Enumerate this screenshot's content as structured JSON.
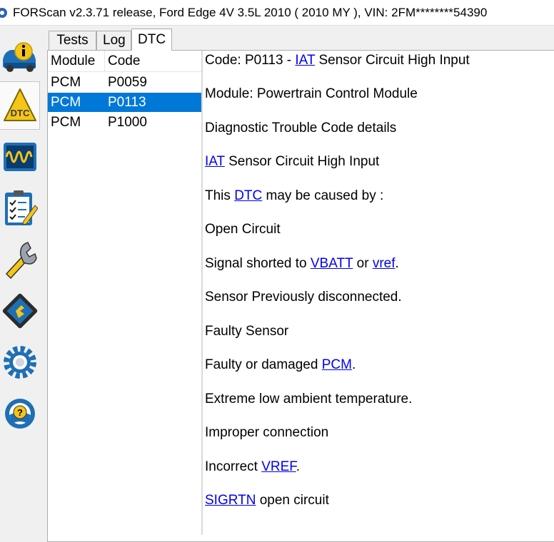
{
  "window": {
    "title": "FORScan v2.3.71 release, Ford Edge 4V 3.5L 2010 ( 2010 MY ), VIN: 2FM********54390"
  },
  "toolbar": {
    "buttons": [
      {
        "name": "vehicle-info",
        "icon": "info-car-icon",
        "active": false
      },
      {
        "name": "dtc",
        "icon": "dtc-warning-icon",
        "active": true,
        "label": "DTC"
      },
      {
        "name": "oscilloscope",
        "icon": "waveform-icon",
        "active": false
      },
      {
        "name": "tests",
        "icon": "checklist-icon",
        "active": false
      },
      {
        "name": "service",
        "icon": "wrench-icon",
        "active": false
      },
      {
        "name": "config",
        "icon": "chip-icon",
        "active": false
      },
      {
        "name": "settings",
        "icon": "gear-icon",
        "active": false
      },
      {
        "name": "help",
        "icon": "help-wheel-icon",
        "active": false,
        "label": "?"
      }
    ]
  },
  "tabs": [
    {
      "label": "Tests",
      "selected": false
    },
    {
      "label": "Log",
      "selected": false
    },
    {
      "label": "DTC",
      "selected": true
    }
  ],
  "dtc_list": {
    "headers": {
      "module": "Module",
      "code": "Code"
    },
    "rows": [
      {
        "module": "PCM",
        "code": "P0059",
        "selected": false
      },
      {
        "module": "PCM",
        "code": "P0113",
        "selected": true
      },
      {
        "module": "PCM",
        "code": "P1000",
        "selected": false
      }
    ]
  },
  "details": {
    "code_line": {
      "prefix": "Code: P0113 - ",
      "link": "IAT",
      "suffix": " Sensor Circuit High Input"
    },
    "module_line": "Module: Powertrain Control Module",
    "section_title": "Diagnostic Trouble Code details",
    "desc_line": {
      "link": "IAT",
      "suffix": " Sensor Circuit High Input"
    },
    "cause_line": {
      "prefix": "This ",
      "link": "DTC",
      "suffix": " may be caused by :"
    },
    "open_circuit": "Open Circuit",
    "shorted_line": {
      "prefix": "Signal shorted to ",
      "link1": "VBATT",
      "mid": " or ",
      "link2": "vref",
      "suffix": "."
    },
    "disconnected": "Sensor Previously disconnected.",
    "faulty_sensor": "Faulty Sensor",
    "pcm_line": {
      "prefix": "Faulty or damaged ",
      "link": "PCM",
      "suffix": "."
    },
    "low_temp": "Extreme low ambient temperature.",
    "improper": "Improper connection",
    "vref_line": {
      "prefix": "Incorrect ",
      "link": "VREF",
      "suffix": "."
    },
    "sigrtn_line": {
      "link": "SIGRTN",
      "suffix": " open circuit"
    }
  },
  "colors": {
    "selection": "#0078d7",
    "link": "#0000ee",
    "icon_blue": "#1e6fb5",
    "icon_yellow": "#f5c518"
  }
}
